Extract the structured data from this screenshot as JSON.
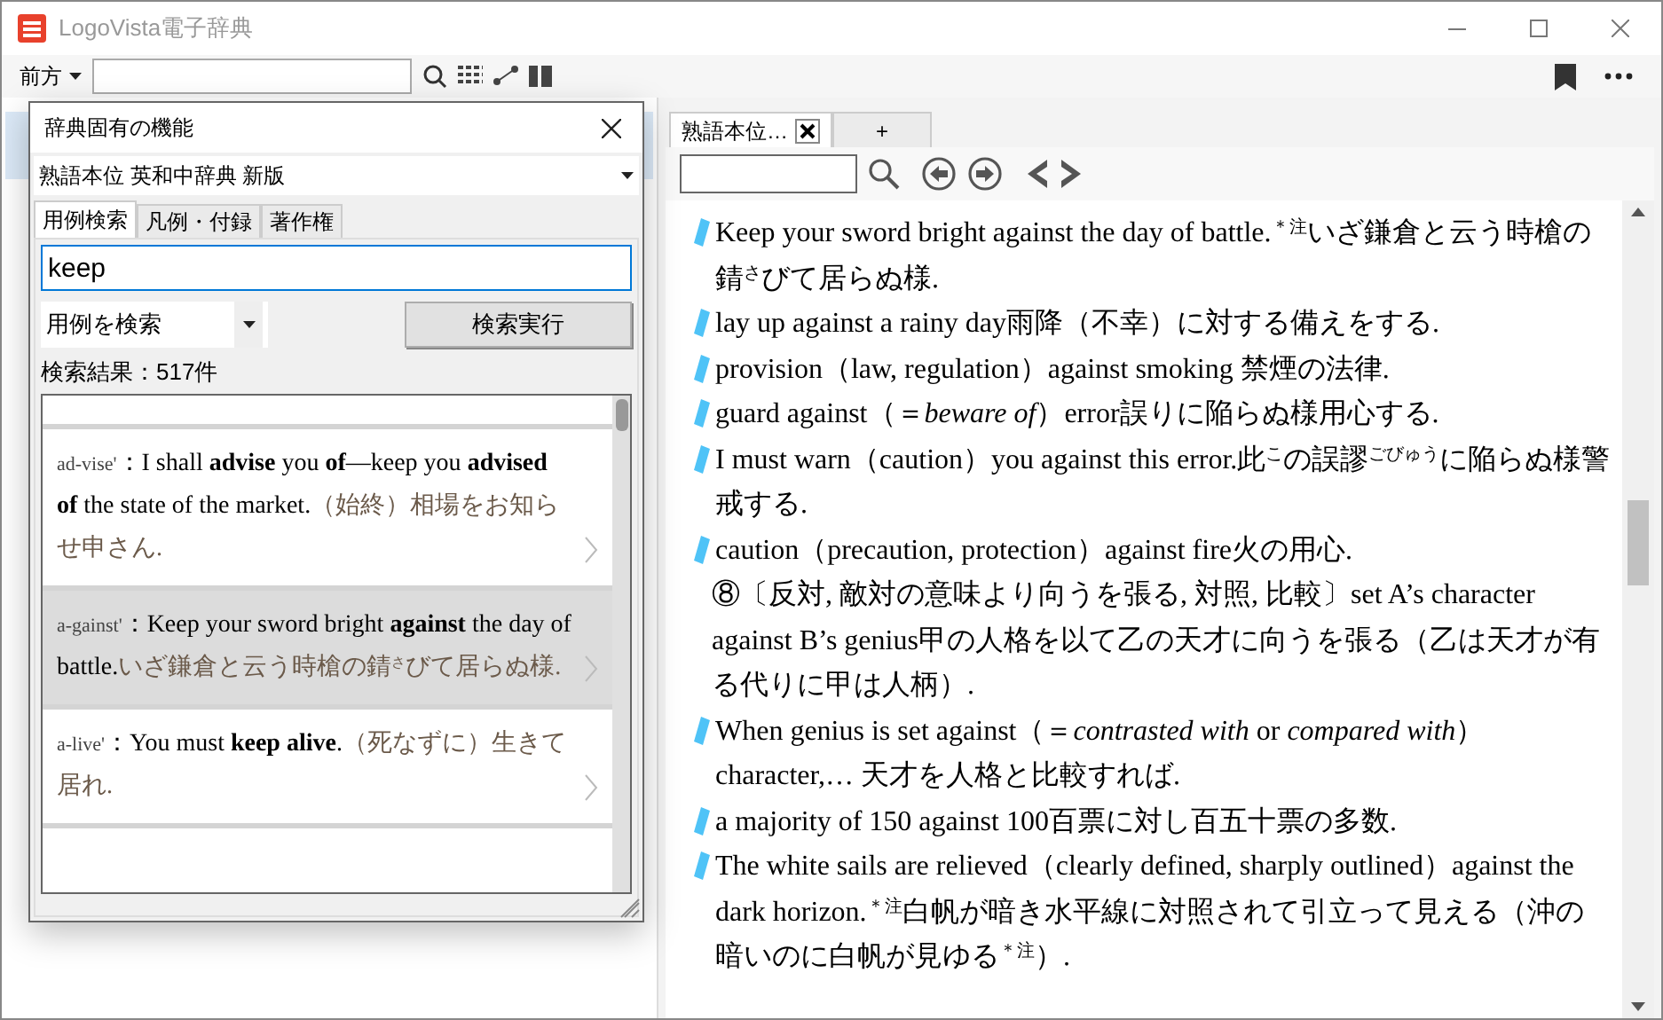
{
  "window": {
    "title": "LogoVista電子辞典"
  },
  "toolbar": {
    "direction": "前方"
  },
  "dialog": {
    "title": "辞典固有の機能",
    "dictionary": "熟語本位 英和中辞典 新版",
    "tabs": [
      {
        "label": "用例検索",
        "selected": true
      },
      {
        "label": "凡例・付録",
        "selected": false
      },
      {
        "label": "著作権",
        "selected": false
      }
    ],
    "search": {
      "value": "keep"
    },
    "mode": "用例を検索",
    "execute_button": "検索実行",
    "result_count": "検索結果：517件",
    "results": [
      {
        "headword": "ad-vise'",
        "separator": "：",
        "text": "I shall **advise** you **of**—keep you **advised of** the state of the market.",
        "translation": "（始終）相場をお知らせ申さん.",
        "selected": false
      },
      {
        "headword": "a-gainst'",
        "separator": "：",
        "text": "Keep your sword bright **against** the day of battle.",
        "translation": "いざ鎌倉と云う時槍の錆$^{さ}$びて居らぬ様.",
        "selected": true
      },
      {
        "headword": "a-live'",
        "separator": "：",
        "text": "You must **keep alive**.",
        "translation": "（死なずに）生きて居れ.",
        "selected": false
      }
    ]
  },
  "viewer": {
    "tabs": [
      {
        "label": "熟語本位…",
        "kind": "document",
        "selected": true
      },
      {
        "label": "+",
        "kind": "new",
        "selected": false
      }
    ],
    "entries": [
      {
        "kind": "example",
        "text": "Keep your sword bright against the day of battle.$^{＊注}$いざ鎌倉と云う時槍の錆$^{さ}$びて居らぬ様."
      },
      {
        "kind": "example",
        "text": "lay up against a rainy day雨降（不幸）に対する備えをする."
      },
      {
        "kind": "example",
        "text": "provision（law, regulation）against smoking 禁煙の法律."
      },
      {
        "kind": "example",
        "text": "guard against（＝*beware of*）error誤りに陥らぬ様用心する."
      },
      {
        "kind": "example",
        "text": "I must warn（caution）you against this error.此$^{こ}$の誤謬$^{ごびゅう}$に陥らぬ様警戒する."
      },
      {
        "kind": "example",
        "text": "caution（precaution, protection）against fire火の用心."
      },
      {
        "kind": "sense",
        "text": "⑧〔反対, 敵対の意味より向うを張る, 対照, 比較〕set A’s character against B’s genius甲の人格を以て乙の天才に向うを張る（乙は天才が有る代りに甲は人柄）."
      },
      {
        "kind": "example",
        "text": "When genius is set against（＝*contrasted with* or *compared with*）character,… 天才を人格と比較すれば."
      },
      {
        "kind": "example",
        "text": "a majority of 150 against 100百票に対し百五十票の多数."
      },
      {
        "kind": "example",
        "text": "The white sails are relieved（clearly defined, sharply outlined）against the dark horizon.$^{＊注}$白帆が暗き水平線に対照されて引立って見える（沖の暗いのに白帆が見ゆる$^{＊注}$）."
      }
    ]
  }
}
